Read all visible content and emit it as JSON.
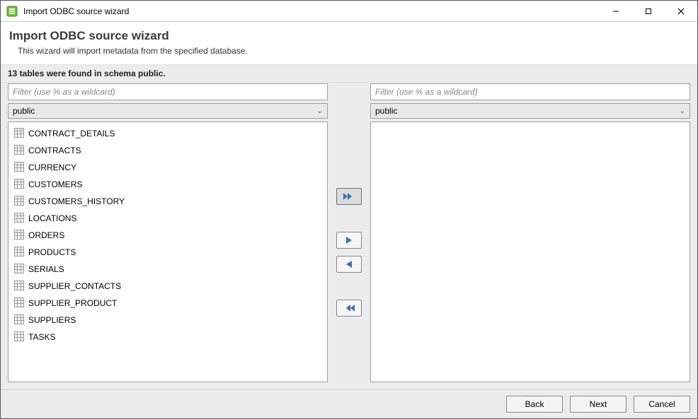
{
  "window": {
    "title": "Import ODBC source wizard"
  },
  "header": {
    "title": "Import ODBC source wizard",
    "subtitle": "This wizard will import metadata from the specified database."
  },
  "status": {
    "message": "13 tables were found in schema public."
  },
  "left": {
    "filter_placeholder": "Filter (use % as a wildcard)",
    "schema": "public",
    "tables": [
      "CONTRACT_DETAILS",
      "CONTRACTS",
      "CURRENCY",
      "CUSTOMERS",
      "CUSTOMERS_HISTORY",
      "LOCATIONS",
      "ORDERS",
      "PRODUCTS",
      "SERIALS",
      "SUPPLIER_CONTACTS",
      "SUPPLIER_PRODUCT",
      "SUPPLIERS",
      "TASKS"
    ]
  },
  "right": {
    "filter_placeholder": "Filter (use % as a wildcard)",
    "schema": "public",
    "tables": []
  },
  "transfer": {
    "add_all": "add-all",
    "add_one": "add-one",
    "remove_one": "remove-one",
    "remove_all": "remove-all"
  },
  "buttons": {
    "back": "Back",
    "next": "Next",
    "cancel": "Cancel"
  },
  "colors": {
    "panel_bg": "#ececec",
    "arrow_color": "#3b6fb8"
  }
}
